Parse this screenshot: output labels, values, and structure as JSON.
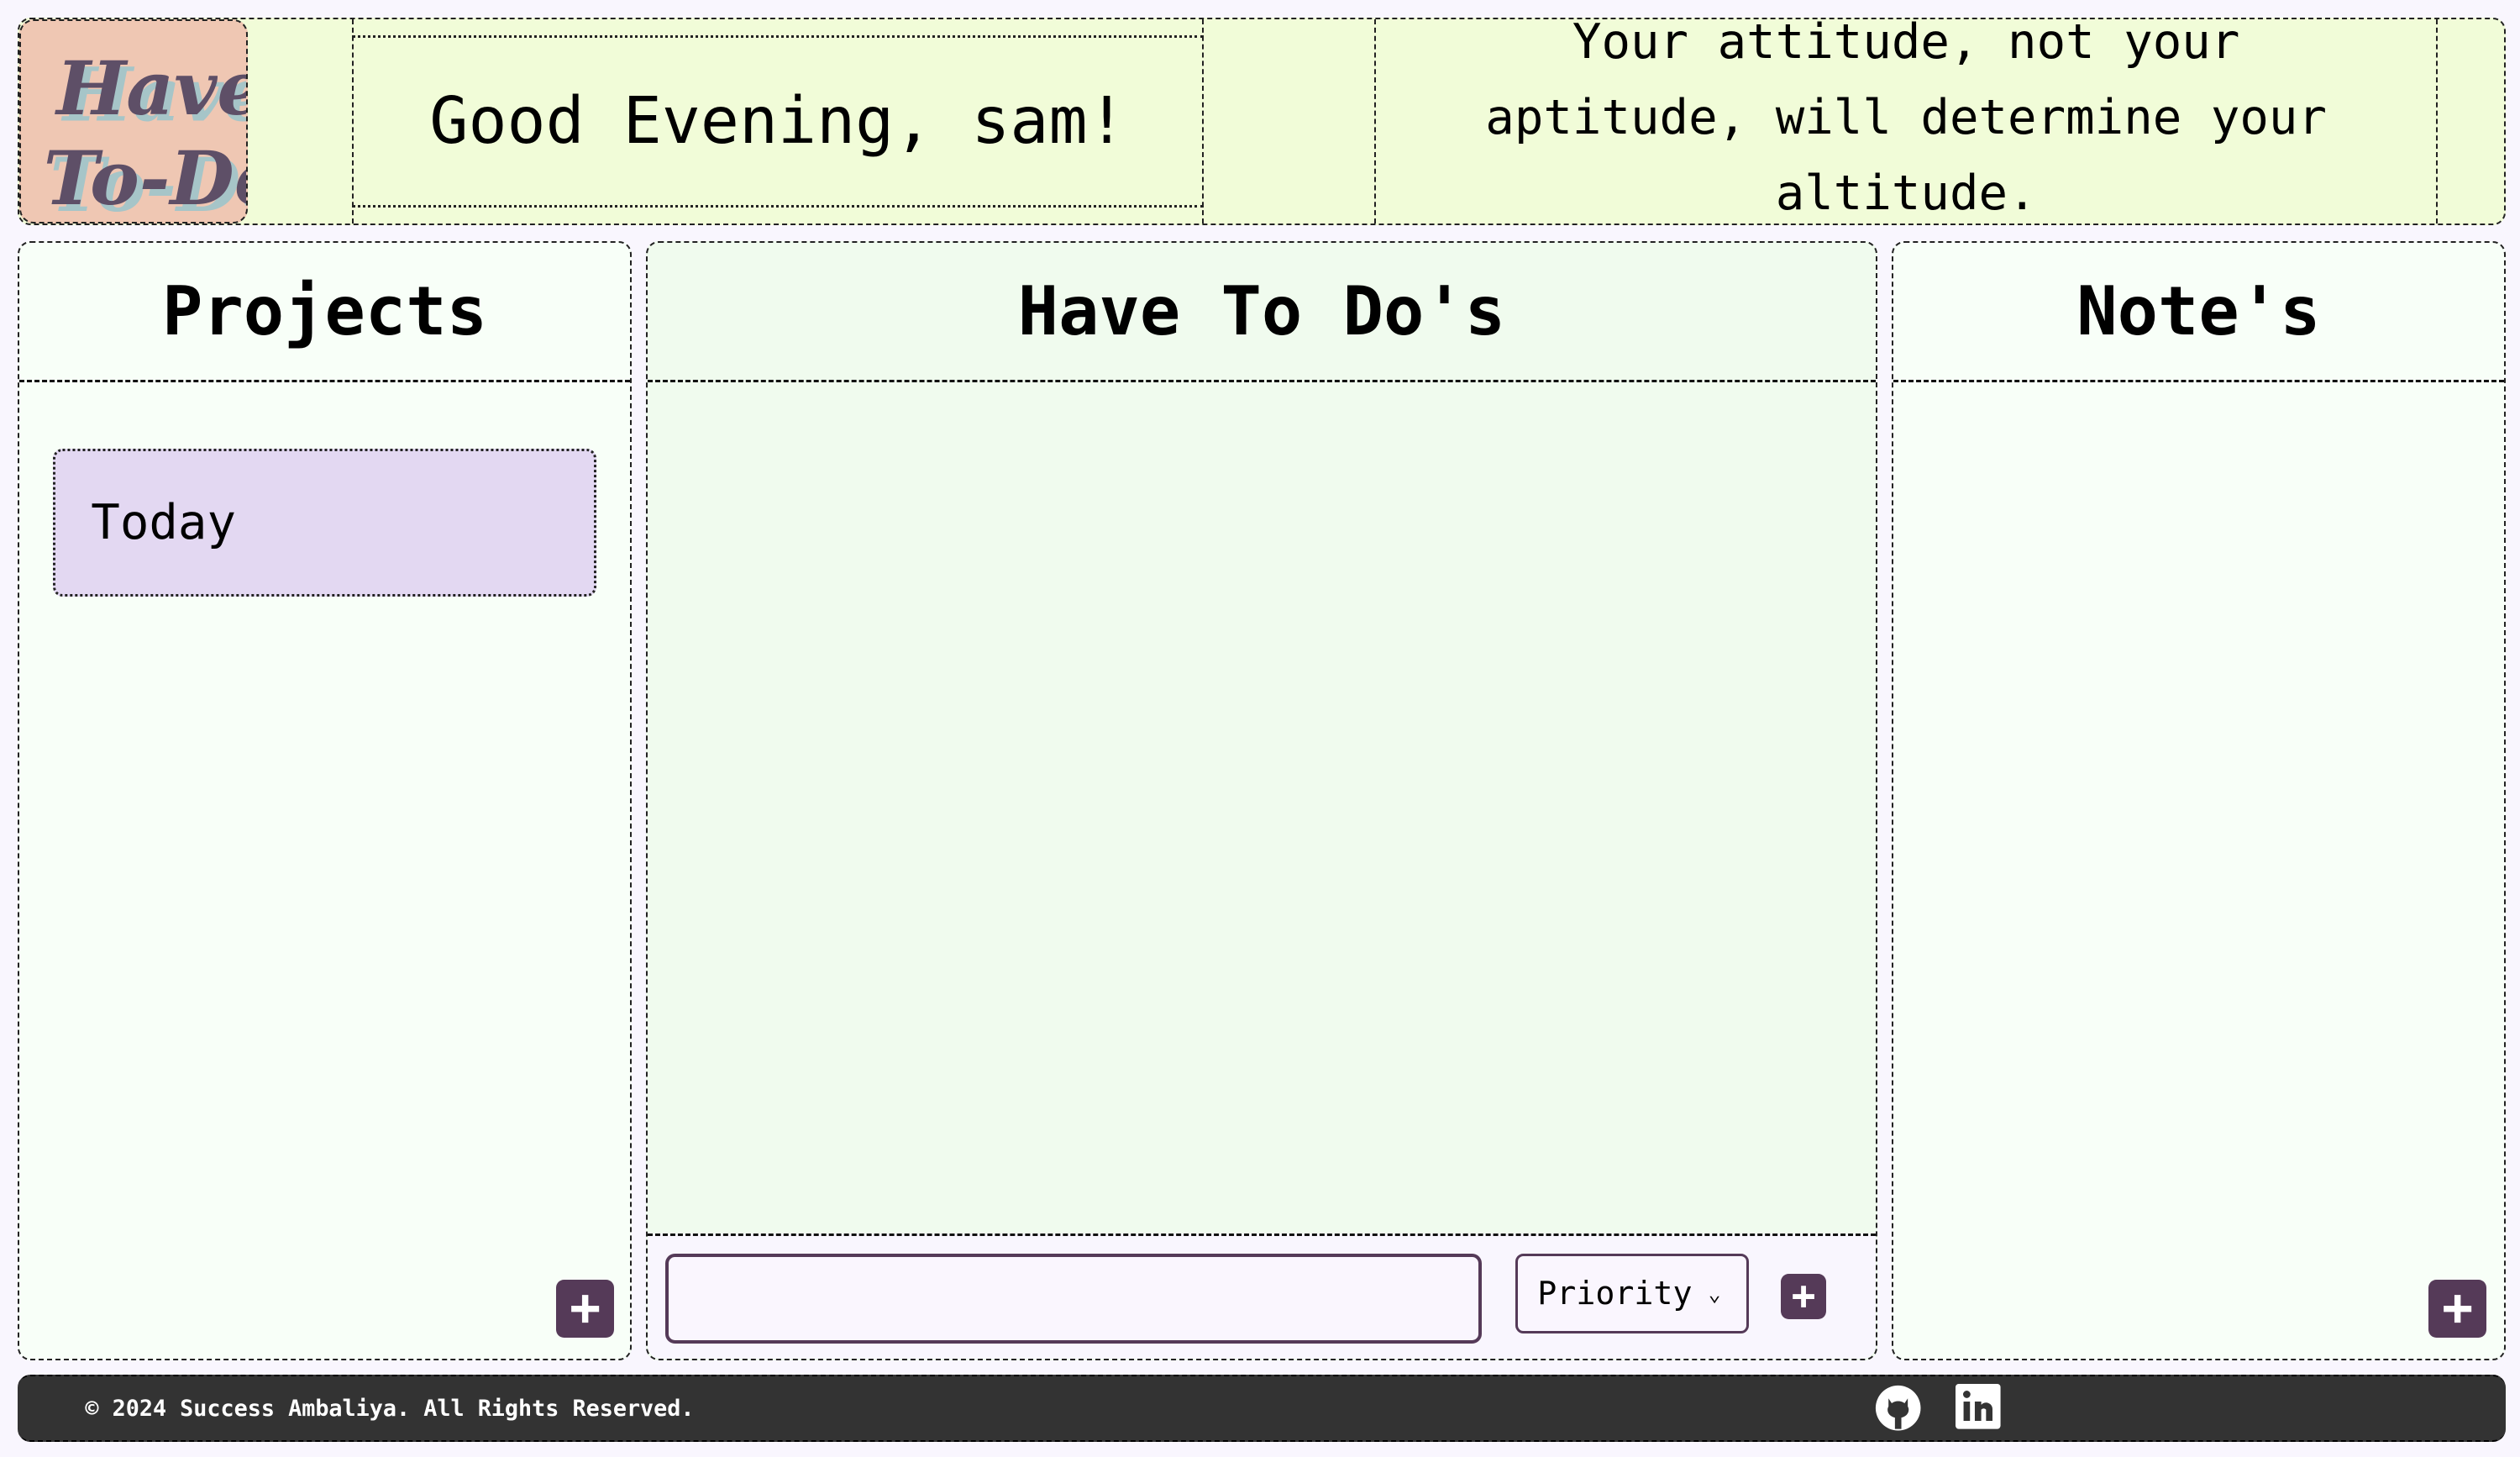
{
  "header": {
    "logo_text": "Have To-Do",
    "greeting": "Good Evening, sam!",
    "quote": "Your attitude, not your aptitude, will determine your altitude."
  },
  "projects": {
    "title": "Projects",
    "items": [
      {
        "label": "Today"
      }
    ],
    "add_icon": "plus-icon"
  },
  "todos": {
    "title": "Have To Do's",
    "input_value": "",
    "priority_select": "Priority",
    "add_icon": "plus-icon"
  },
  "notes": {
    "title": "Note's",
    "add_icon": "plus-icon"
  },
  "footer": {
    "copyright": "© 2024 Success Ambaliya. All Rights Reserved.",
    "icons": [
      "github-icon",
      "linkedin-icon"
    ]
  },
  "colors": {
    "accent": "#553a58",
    "header_bg": "#f1fcd8",
    "logo_bg": "#efc7b3",
    "project_item_bg": "#e3d8f2",
    "footer_bg": "#333333"
  }
}
